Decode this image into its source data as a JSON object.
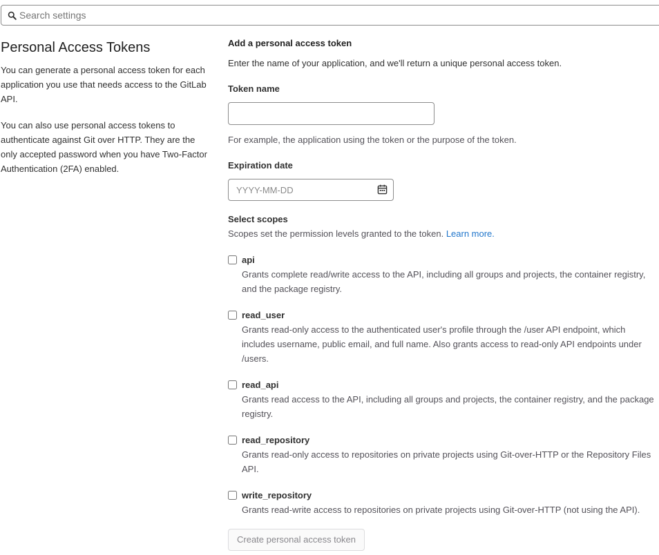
{
  "search": {
    "placeholder": "Search settings",
    "icon": "search-icon"
  },
  "sidebar": {
    "title": "Personal Access Tokens",
    "paragraph1": "You can generate a personal access token for each application you use that needs access to the GitLab API.",
    "paragraph2": "You can also use personal access tokens to authenticate against Git over HTTP. They are the only accepted password when you have Two-Factor Authentication (2FA) enabled."
  },
  "form": {
    "section_title": "Add a personal access token",
    "section_description": "Enter the name of your application, and we'll return a unique personal access token.",
    "token_name_label": "Token name",
    "token_name_value": "",
    "token_name_help": "For example, the application using the token or the purpose of the token.",
    "expiration_label": "Expiration date",
    "expiration_placeholder": "YYYY-MM-DD",
    "expiration_icon": "calendar-icon",
    "scopes_label": "Select scopes",
    "scopes_description": "Scopes set the permission levels granted to the token.",
    "learn_more": "Learn more.",
    "scopes": [
      {
        "name": "api",
        "checked": false,
        "description": "Grants complete read/write access to the API, including all groups and projects, the container registry, and the package registry."
      },
      {
        "name": "read_user",
        "checked": false,
        "description": "Grants read-only access to the authenticated user's profile through the /user API endpoint, which includes username, public email, and full name. Also grants access to read-only API endpoints under /users."
      },
      {
        "name": "read_api",
        "checked": false,
        "description": "Grants read access to the API, including all groups and projects, the container registry, and the package registry."
      },
      {
        "name": "read_repository",
        "checked": false,
        "description": "Grants read-only access to repositories on private projects using Git-over-HTTP or the Repository Files API."
      },
      {
        "name": "write_repository",
        "checked": false,
        "description": "Grants read-write access to repositories on private projects using Git-over-HTTP (not using the API)."
      }
    ],
    "submit_label": "Create personal access token",
    "submit_disabled": true
  },
  "colors": {
    "link": "#1f75cb",
    "text": "#303030",
    "muted": "#535158",
    "border": "#8c8c8c"
  }
}
